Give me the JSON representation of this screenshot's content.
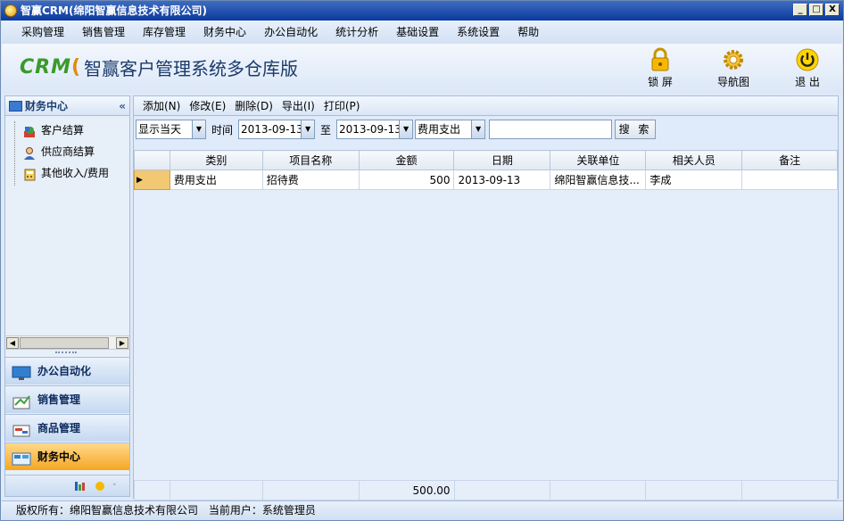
{
  "window": {
    "title": "智赢CRM(绵阳智赢信息技术有限公司)",
    "buttons": [
      "_",
      "□",
      "X"
    ]
  },
  "menu": [
    "采购管理",
    "销售管理",
    "库存管理",
    "财务中心",
    "办公自动化",
    "统计分析",
    "基础设置",
    "系统设置",
    "帮助"
  ],
  "banner": {
    "logo_crm": "CRM",
    "logo_text": "智赢客户管理系统多仓库版",
    "tools": [
      {
        "label": "锁 屏",
        "icon": "lock-icon"
      },
      {
        "label": "导航图",
        "icon": "gear-icon"
      },
      {
        "label": "退 出",
        "icon": "power-icon"
      }
    ]
  },
  "sidebar": {
    "header": "财务中心",
    "collapse": "«",
    "tree": [
      {
        "label": "客户结算",
        "icon": "customer-settlement-icon"
      },
      {
        "label": "供应商结算",
        "icon": "supplier-icon"
      },
      {
        "label": "其他收入/费用",
        "icon": "calculator-icon"
      }
    ],
    "nav": [
      {
        "label": "办公自动化",
        "icon": "monitor-icon"
      },
      {
        "label": "销售管理",
        "icon": "sales-icon"
      },
      {
        "label": "商品管理",
        "icon": "goods-icon"
      },
      {
        "label": "财务中心",
        "icon": "finance-icon"
      }
    ]
  },
  "actions": [
    "添加(N)",
    "修改(E)",
    "删除(D)",
    "导出(I)",
    "打印(P)"
  ],
  "filter": {
    "period": "显示当天",
    "time_label": "时间",
    "date_from": "2013-09-13",
    "to_label": "至",
    "date_to": "2013-09-13",
    "type": "费用支出",
    "search_value": "",
    "search_button": "搜 索"
  },
  "table": {
    "columns": [
      "",
      "类别",
      "项目名称",
      "金额",
      "日期",
      "关联单位",
      "相关人员",
      "备注"
    ],
    "rows": [
      {
        "category": "费用支出",
        "item": "招待费",
        "amount": "500",
        "date": "2013-09-13",
        "unit": "绵阳智赢信息技...",
        "person": "李成",
        "note": ""
      }
    ],
    "total_amount": "500.00"
  },
  "status": {
    "copyright": "版权所有：绵阳智赢信息技术有限公司",
    "user": "当前用户：系统管理员"
  }
}
